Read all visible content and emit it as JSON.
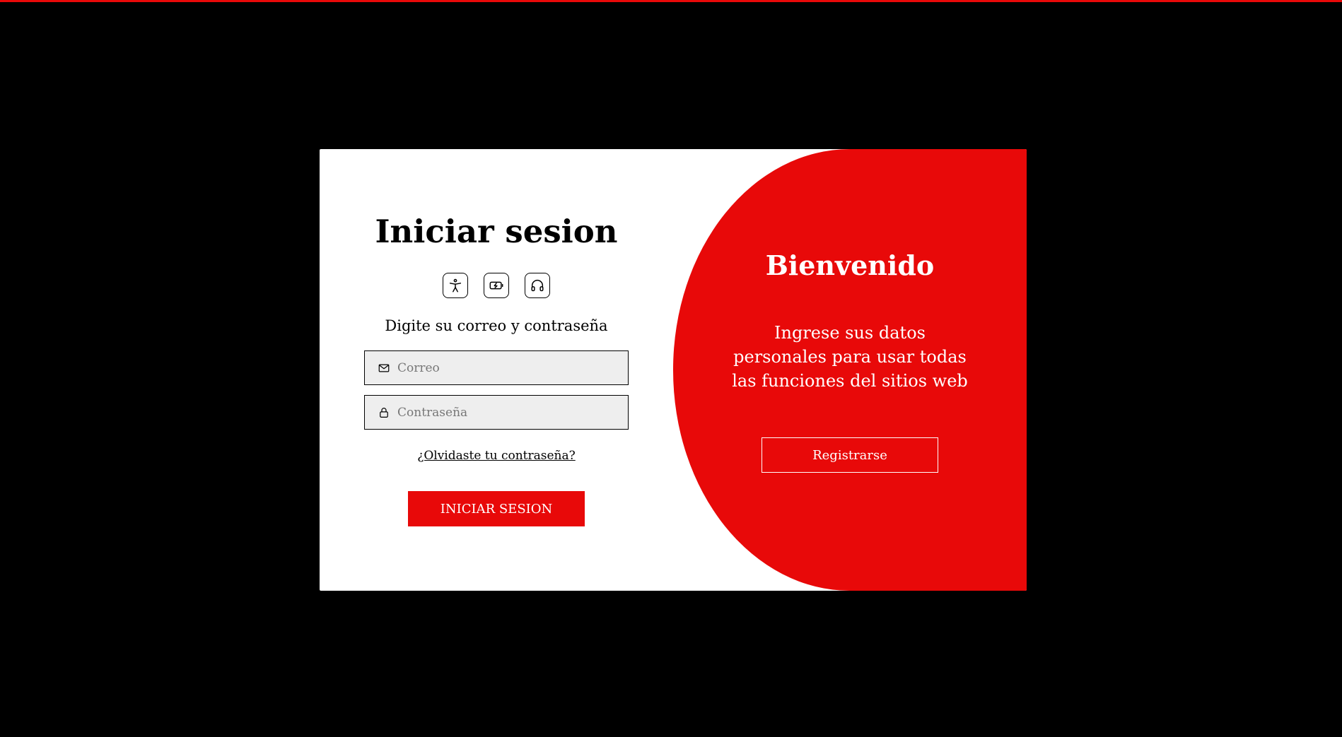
{
  "colors": {
    "accent": "#e80909",
    "background": "#000000",
    "card": "#ffffff",
    "field_bg": "#eeeeee"
  },
  "login": {
    "title": "Iniciar sesion",
    "icons": [
      "accessibility-icon",
      "battery-icon",
      "headphones-icon"
    ],
    "subtitle": "Digite su correo y contraseña",
    "email": {
      "placeholder": "Correo",
      "value": "",
      "icon": "mail-icon"
    },
    "password": {
      "placeholder": "Contraseña",
      "value": "",
      "icon": "lock-icon"
    },
    "forgot_label": "¿Olvidaste tu contraseña?",
    "submit_label": "INICIAR SESION"
  },
  "welcome": {
    "title": "Bienvenido",
    "text": "Ingrese sus datos personales para usar todas las funciones del sitios web",
    "register_label": "Registrarse"
  }
}
